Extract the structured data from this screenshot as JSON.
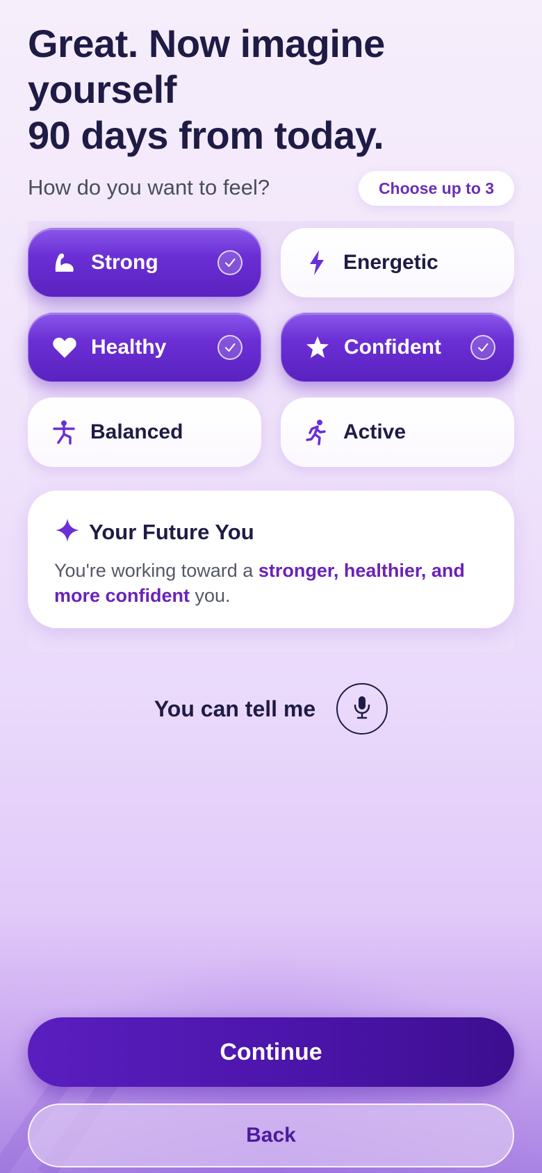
{
  "header": {
    "title_lines": [
      "Great. Now imagine",
      "yourself",
      "90 days from today."
    ],
    "question": "How do you want to feel?",
    "limit_badge": "Choose up to 3"
  },
  "options": [
    {
      "label": "Strong",
      "icon": "flexed-arm-icon",
      "selected": true
    },
    {
      "label": "Energetic",
      "icon": "lightning-bolt-icon",
      "selected": false
    },
    {
      "label": "Healthy",
      "icon": "heart-icon",
      "selected": true
    },
    {
      "label": "Confident",
      "icon": "star-icon",
      "selected": true
    },
    {
      "label": "Balanced",
      "icon": "yoga-pose-icon",
      "selected": false
    },
    {
      "label": "Active",
      "icon": "running-person-icon",
      "selected": false
    }
  ],
  "future_card": {
    "title": "Your Future You",
    "icon": "sparkle-icon",
    "text_before": "You're working toward a ",
    "text_highlight": "stronger, healthier, and more confident",
    "text_after": " you."
  },
  "voice": {
    "label": "You can tell me",
    "icon": "microphone-icon"
  },
  "actions": {
    "continue_label": "Continue",
    "back_label": "Back"
  },
  "colors": {
    "accent": "#6b2fd5",
    "primary_button": "#4a14a8",
    "text_dark": "#1e1b45",
    "highlight_text": "#6a22b8"
  }
}
